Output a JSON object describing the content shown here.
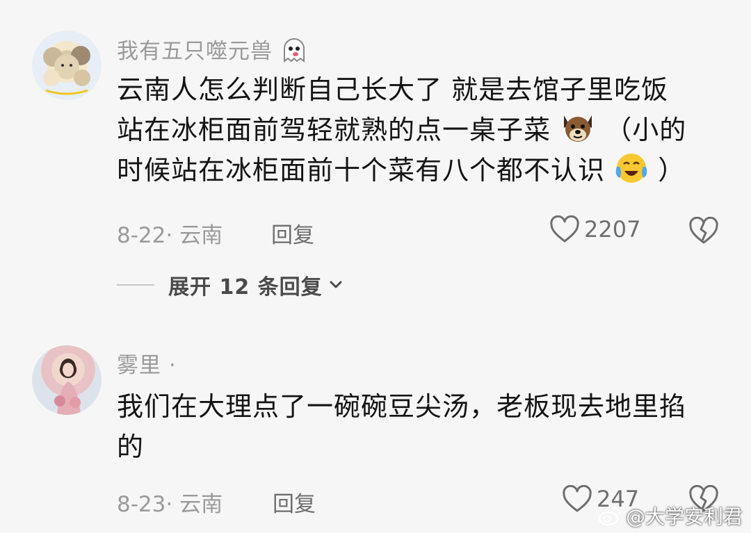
{
  "comments": [
    {
      "username": "我有五只噬元兽",
      "text_line1": "云南人怎么判断自己长大了 就是去馆子里吃饭",
      "text_line2_a": "站在冰柜面前驾轻就熟的点一桌子菜",
      "text_line2_b": "（小的",
      "text_line3": "时候站在冰柜面前十个菜有八个都不认识",
      "text_line3_end": "）",
      "date_location": "8-22· 云南",
      "reply_label": "回复",
      "likes": "2207"
    },
    {
      "username": "雾里 ·",
      "text_line1": "我们在大理点了一碗碗豆尖汤，老板现去地里掐",
      "text_line2": "的",
      "date_location": "8-23· 云南",
      "reply_label": "回复",
      "likes": "247"
    }
  ],
  "expand_replies": "展开 12 条回复",
  "watermark": "@大学安利君",
  "colors": {
    "background": "#f6f6f6",
    "meta": "#9a9a9a",
    "text": "#141414"
  }
}
